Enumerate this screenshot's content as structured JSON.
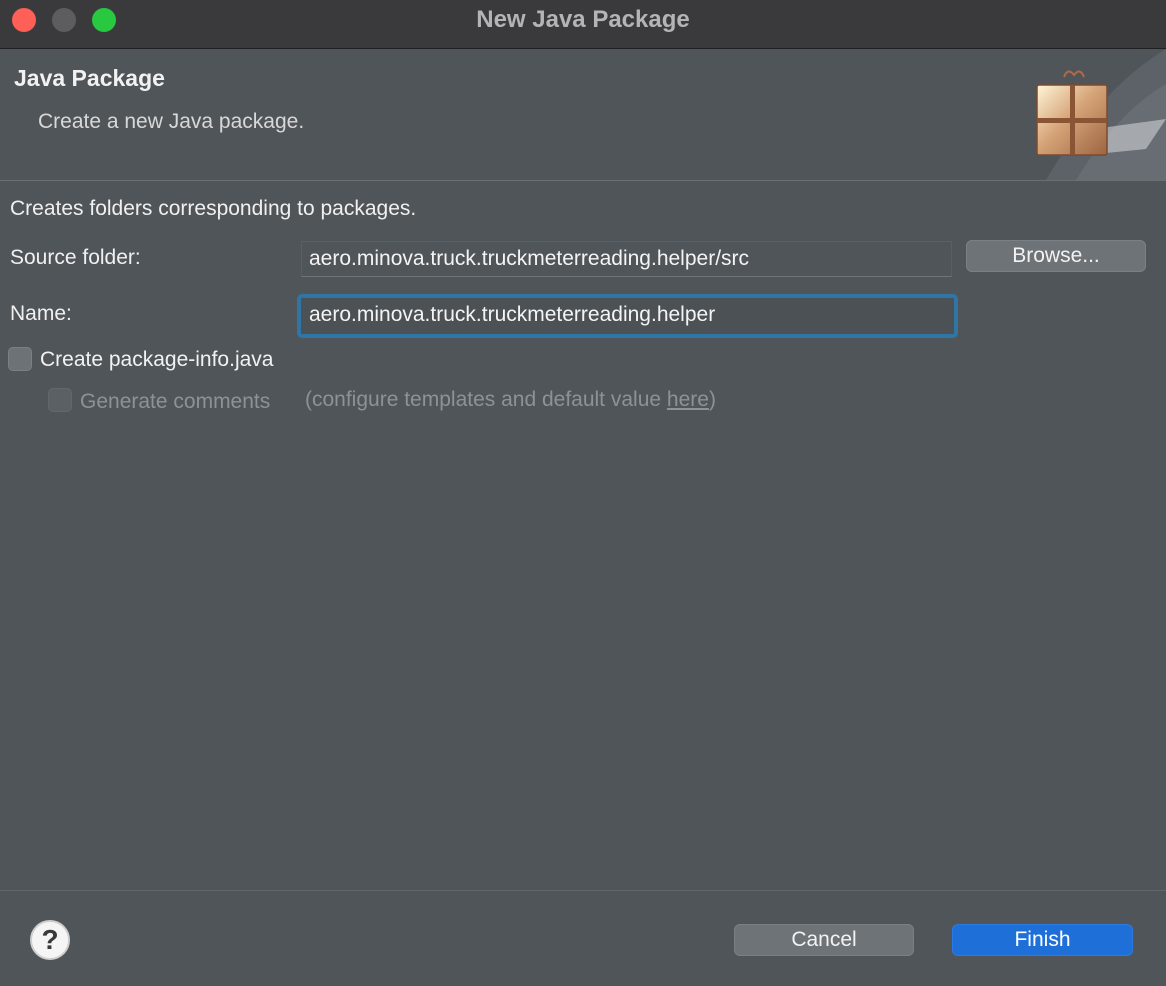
{
  "window": {
    "title": "New Java Package"
  },
  "header": {
    "title": "Java Package",
    "description": "Create a new Java package."
  },
  "form": {
    "intro": "Creates folders corresponding to packages.",
    "source_folder_label": "Source folder:",
    "source_folder_value": "aero.minova.truck.truckmeterreading.helper/src",
    "browse_label": "Browse...",
    "name_label": "Name:",
    "name_value": "aero.minova.truck.truckmeterreading.helper",
    "create_package_info_label": "Create package-info.java",
    "create_package_info_checked": false,
    "generate_comments_label": "Generate comments",
    "generate_comments_checked": false,
    "generate_comments_enabled": false,
    "hint_prefix": "(configure templates and default value ",
    "hint_link": "here",
    "hint_suffix": ")"
  },
  "footer": {
    "help_glyph": "?",
    "cancel_label": "Cancel",
    "finish_label": "Finish"
  },
  "colors": {
    "accent": "#1e6fd8",
    "focus_ring": "#2f75a6",
    "background": "#50555a"
  },
  "icons": {
    "banner": "package-wizard-icon",
    "help": "help-icon"
  }
}
